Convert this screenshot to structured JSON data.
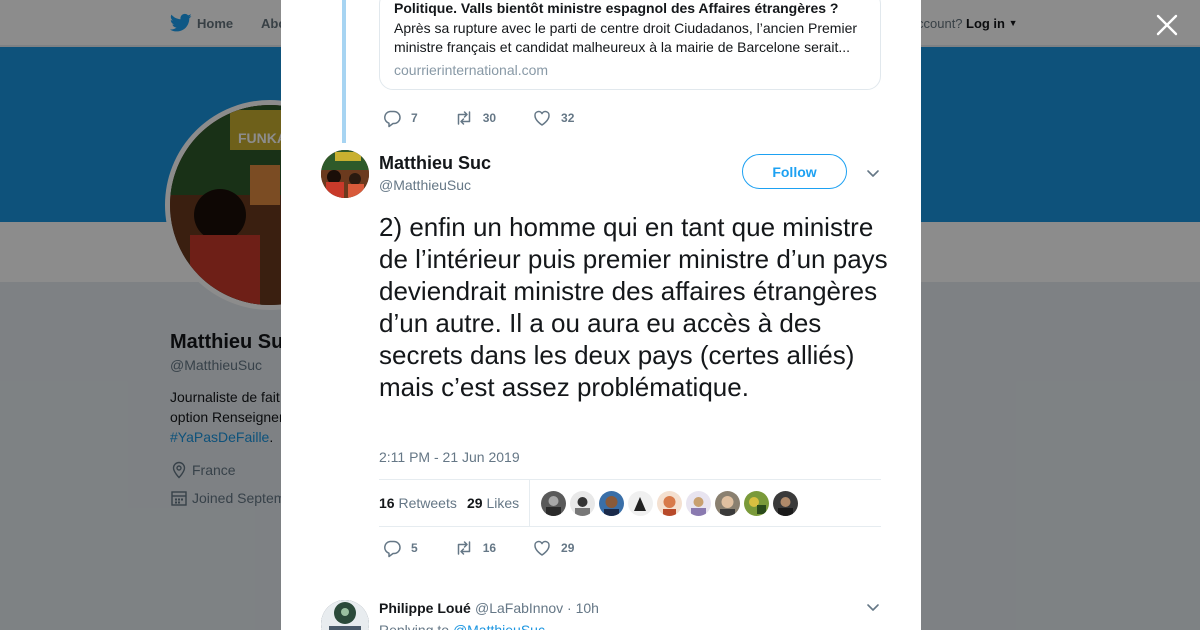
{
  "background_page": {
    "nav": {
      "home_label": "Home",
      "about_label": "Abo",
      "account_text": "ccount?",
      "login_label": "Log in"
    },
    "profile": {
      "name": "Matthieu Su",
      "handle": "@MatthieuSuc",
      "bio_line1": "Journaliste de fait",
      "bio_line2": "option Renseigner",
      "hashtag": "#YaPasDeFaille",
      "hashtag_suffix": ".",
      "location": "France",
      "joined": "Joined Septem"
    },
    "colors": {
      "banner": "#1b95e0"
    }
  },
  "modal": {
    "previous_tweet": {
      "card": {
        "title": "Politique. Valls bientôt ministre espagnol des Affaires étrangères ?",
        "description": "Après sa rupture avec le parti de centre droit Ciudadanos, l’ancien Premier ministre français et candidat malheureux à la mairie de Barcelone serait...",
        "domain": "courrierinternational.com"
      },
      "actions": {
        "replies": "7",
        "retweets": "30",
        "likes": "32"
      }
    },
    "main_tweet": {
      "author_name": "Matthieu Suc",
      "author_handle": "@MatthieuSuc",
      "follow_label": "Follow",
      "text": "2) enfin un homme qui en tant que ministre de l’intérieur puis premier ministre d’un pays deviendrait ministre des affaires étrangères d’un autre. Il a ou aura eu accès à des secrets dans les deux pays (certes alliés) mais c’est assez problématique.",
      "timestamp": "2:11 PM - 21 Jun 2019",
      "stats": {
        "retweets_count": "16",
        "retweets_label": "Retweets",
        "likes_count": "29",
        "likes_label": "Likes"
      },
      "actions": {
        "replies": "5",
        "retweets": "16",
        "likes": "29"
      }
    },
    "reply": {
      "author_name": "Philippe Loué",
      "author_handle": "@LaFabInnov · 10h",
      "replying_prefix": "Replying to",
      "replying_mention": "@MatthieuSuc"
    }
  },
  "icons": [
    "twitter-bird-icon",
    "close-icon",
    "reply-icon",
    "retweet-icon",
    "heart-icon",
    "chevron-down-icon",
    "location-icon",
    "calendar-icon"
  ]
}
